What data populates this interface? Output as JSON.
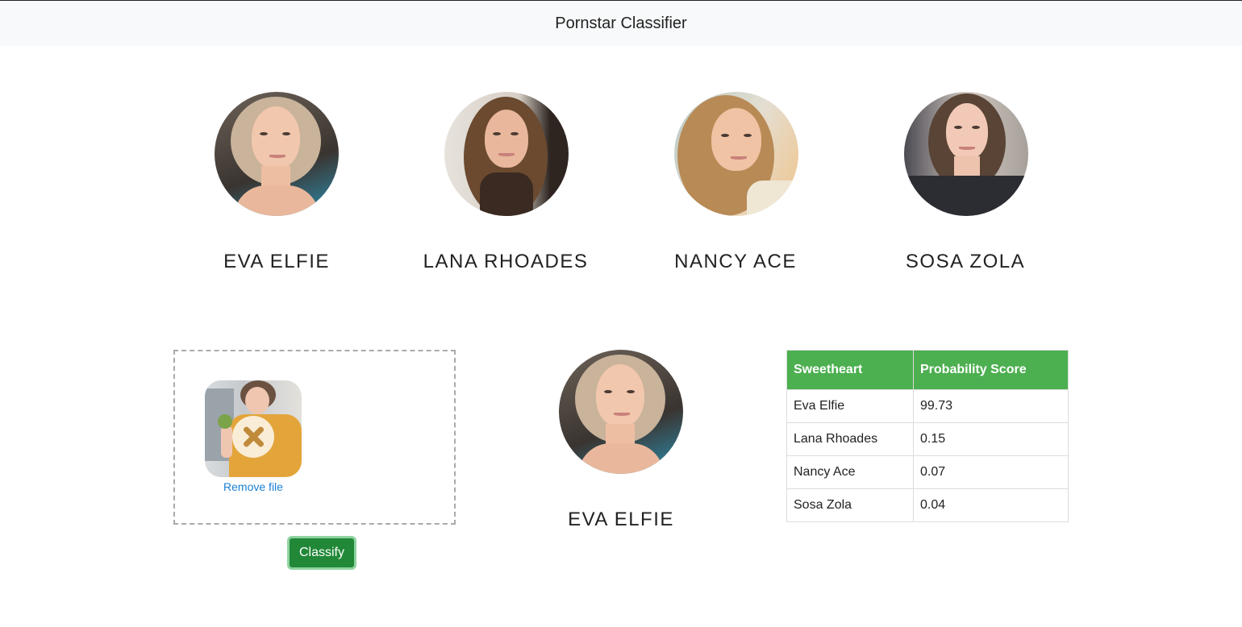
{
  "navbar": {
    "title": "Pornstar Classifier"
  },
  "gallery": [
    {
      "name": "EVA ELFIE"
    },
    {
      "name": "LANA RHOADES"
    },
    {
      "name": "NANCY ACE"
    },
    {
      "name": "SOSA ZOLA"
    }
  ],
  "upload": {
    "remove_label": "Remove file"
  },
  "classify_button": "Classify",
  "result": {
    "name": "EVA ELFIE"
  },
  "table": {
    "headers": [
      "Sweetheart",
      "Probability Score"
    ],
    "rows": [
      [
        "Eva Elfie",
        "99.73"
      ],
      [
        "Lana Rhoades",
        "0.15"
      ],
      [
        "Nancy Ace",
        "0.07"
      ],
      [
        "Sosa Zola",
        "0.04"
      ]
    ]
  }
}
